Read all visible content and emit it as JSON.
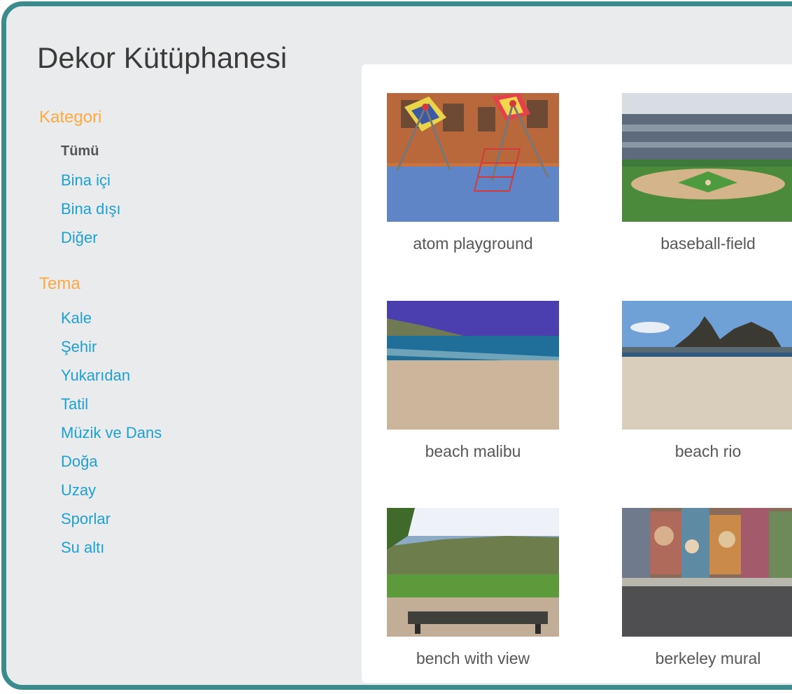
{
  "library": {
    "title": "Dekor Kütüphanesi"
  },
  "sidebar": {
    "category_heading": "Kategori",
    "categories": [
      {
        "label": "Tümü",
        "active": true
      },
      {
        "label": "Bina içi",
        "active": false
      },
      {
        "label": "Bina dışı",
        "active": false
      },
      {
        "label": "Diğer",
        "active": false
      }
    ],
    "theme_heading": "Tema",
    "themes": [
      {
        "label": "Kale"
      },
      {
        "label": "Şehir"
      },
      {
        "label": "Yukarıdan"
      },
      {
        "label": "Tatil"
      },
      {
        "label": "Müzik ve Dans"
      },
      {
        "label": "Doğa"
      },
      {
        "label": "Uzay"
      },
      {
        "label": "Sporlar"
      },
      {
        "label": "Su altı"
      }
    ]
  },
  "backdrops": [
    {
      "name": "atom playground"
    },
    {
      "name": "baseball-field"
    },
    {
      "name": "beach malibu"
    },
    {
      "name": "beach rio"
    },
    {
      "name": "bench with view"
    },
    {
      "name": "berkeley mural"
    }
  ],
  "colors": {
    "frame_border": "#3c8b8c",
    "heading_orange": "#ffa941",
    "link_blue": "#1da1d4",
    "panel_bg": "#e9ebec"
  }
}
